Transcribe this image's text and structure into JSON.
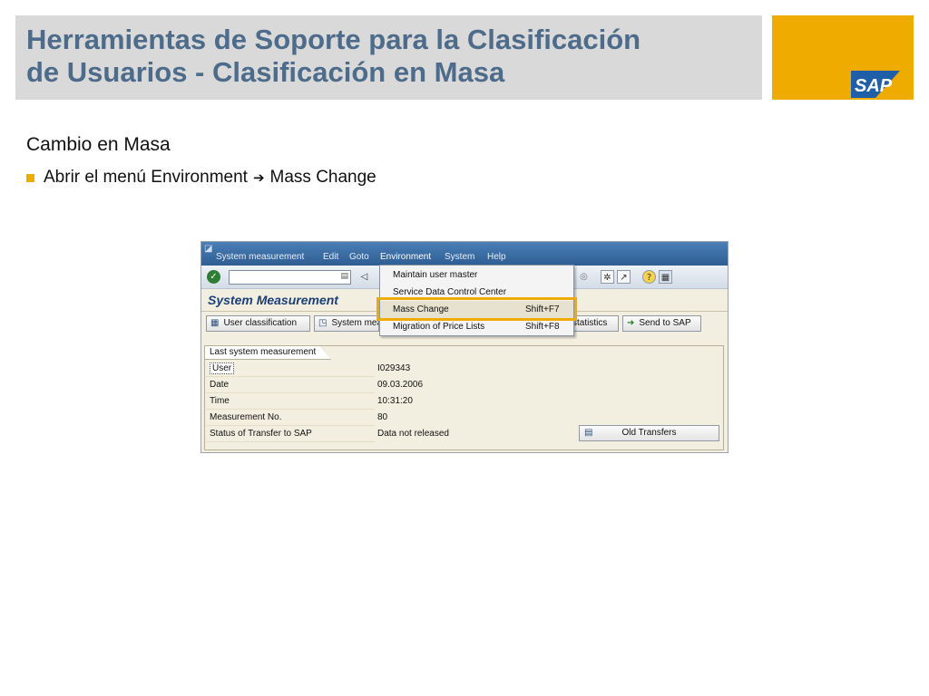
{
  "slide": {
    "title_line1": "Herramientas de Soporte para la Clasificación",
    "title_line2": "de Usuarios - Clasificación en Masa",
    "subtitle": "Cambio en Masa",
    "bullet_prefix": "Abrir el menú Environment",
    "bullet_suffix": "Mass Change",
    "logo": "SAP",
    "colors": {
      "accent": "#f0ab00",
      "title": "#4d6b8a",
      "logo_blue": "#1e5fa8"
    }
  },
  "gui": {
    "menu": [
      {
        "label": "System measurement"
      },
      {
        "label": "Edit"
      },
      {
        "label": "Goto"
      },
      {
        "label": "Environment"
      },
      {
        "label": "System"
      },
      {
        "label": "Help"
      }
    ],
    "toolbar": {
      "command_value": ""
    },
    "screen_title": "System Measurement",
    "app_buttons": {
      "user_classification": "User classification",
      "system_measurement": "System measurement",
      "statistics": "statistics",
      "send_to_sap": "Send to SAP"
    },
    "dropdown": [
      {
        "label": "Maintain user master",
        "shortcut": ""
      },
      {
        "label": "Service Data Control Center",
        "shortcut": ""
      },
      {
        "label": "Mass Change",
        "shortcut": "Shift+F7"
      },
      {
        "label": "Migration of Price Lists",
        "shortcut": "Shift+F8"
      }
    ],
    "group": {
      "title": "Last system measurement",
      "rows": [
        {
          "label": "User",
          "value": "I029343"
        },
        {
          "label": "Date",
          "value": "09.03.2006"
        },
        {
          "label": "Time",
          "value": "10:31:20"
        },
        {
          "label": "Measurement No.",
          "value": "80"
        },
        {
          "label": "Status of Transfer to SAP",
          "value": "Data not released"
        }
      ],
      "old_transfers": "Old Transfers"
    }
  }
}
